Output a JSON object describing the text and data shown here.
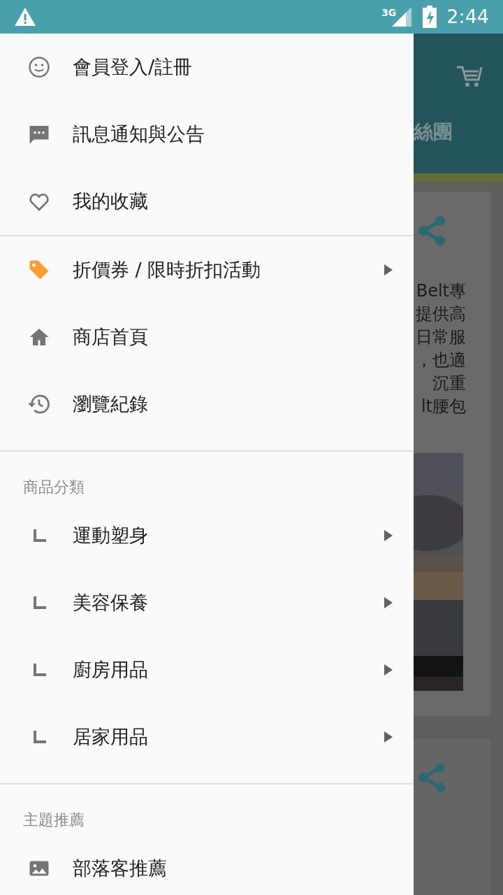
{
  "status_bar": {
    "network": "3G",
    "time": "2:44"
  },
  "drawer": {
    "sections": [
      {
        "items": [
          {
            "label": "會員登入/註冊",
            "kind": "link",
            "submenu": false
          },
          {
            "label": "訊息通知與公告",
            "kind": "link",
            "submenu": false
          },
          {
            "label": "我的收藏",
            "kind": "link",
            "submenu": false
          }
        ]
      },
      {
        "items": [
          {
            "label": "折價券 / 限時折扣活動",
            "kind": "link",
            "submenu": true
          },
          {
            "label": "商店首頁",
            "kind": "link",
            "submenu": false
          },
          {
            "label": "瀏覽紀錄",
            "kind": "link",
            "submenu": false
          }
        ]
      },
      {
        "title": "商品分類",
        "items": [
          {
            "label": "運動塑身",
            "kind": "category",
            "submenu": true
          },
          {
            "label": "美容保養",
            "kind": "category",
            "submenu": true
          },
          {
            "label": "廚房用品",
            "kind": "category",
            "submenu": true
          },
          {
            "label": "居家用品",
            "kind": "category",
            "submenu": true
          }
        ]
      },
      {
        "title": "主題推薦",
        "items": [
          {
            "label": "部落客推薦",
            "kind": "link",
            "submenu": false
          }
        ]
      }
    ]
  },
  "background": {
    "tab_label": "絲團",
    "card_text": [
      "Belt專",
      "提供高",
      "日常服",
      "，也適",
      "沉重",
      "lt腰包"
    ]
  }
}
